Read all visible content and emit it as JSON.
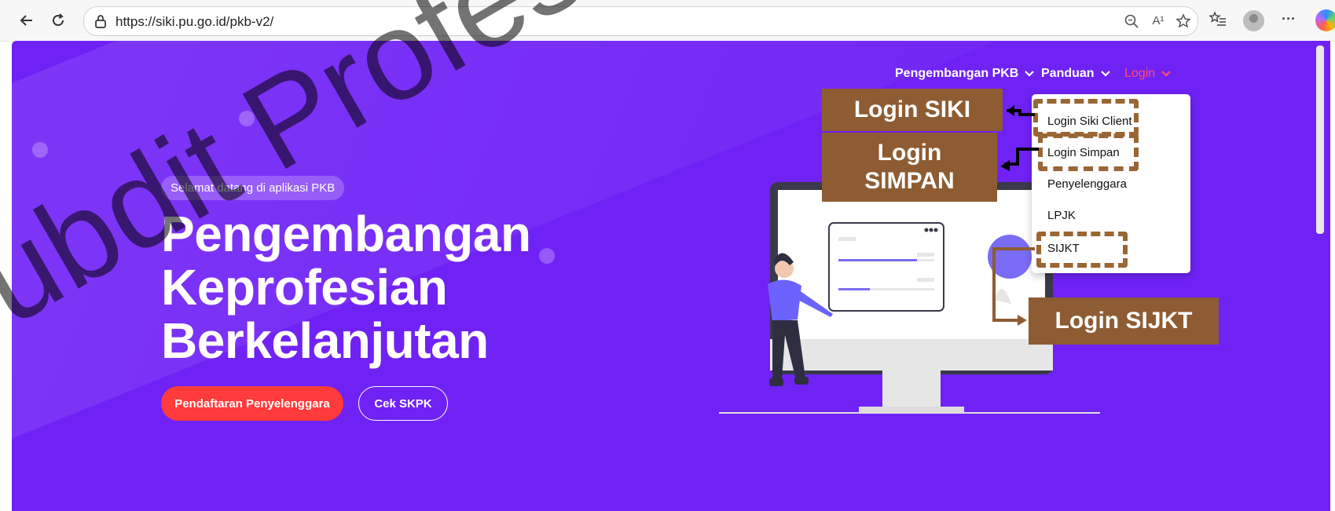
{
  "browser": {
    "url": "https://siki.pu.go.id/pkb-v2/",
    "icons": [
      "back-icon",
      "refresh-icon",
      "lock-icon",
      "zoom-icon",
      "read-aloud-icon",
      "favorite-icon",
      "favorites-list-icon",
      "profile-icon",
      "more-icon",
      "copilot-icon"
    ],
    "read_aloud_label": "A¹"
  },
  "nav": {
    "items": [
      {
        "label": "Pengembangan PKB",
        "color": "#ffffff"
      },
      {
        "label": "Panduan",
        "color": "#ffffff"
      },
      {
        "label": "Login",
        "color": "#ff4d6d"
      }
    ]
  },
  "hero": {
    "welcome": "Selamat datang di aplikasi PKB",
    "title_lines": [
      "Pengembangan",
      "Keprofesian",
      "Berkelanjutan"
    ],
    "primary_button": "Pendaftaran Penyelenggara",
    "secondary_button": "Cek SKPK",
    "background": "#7022f5"
  },
  "dropdown": {
    "items": [
      "Login Siki Client",
      "Login Simpan",
      "Penyelenggara",
      "LPJK",
      "SIJKT"
    ]
  },
  "annotations": {
    "login_siki": "Login SIKI",
    "login_simpan_line1": "Login",
    "login_simpan_line2": "SIMPAN",
    "login_sijkt": "Login SIJKT",
    "color": "#8e5c32"
  },
  "watermark": "ubdit Profesi"
}
